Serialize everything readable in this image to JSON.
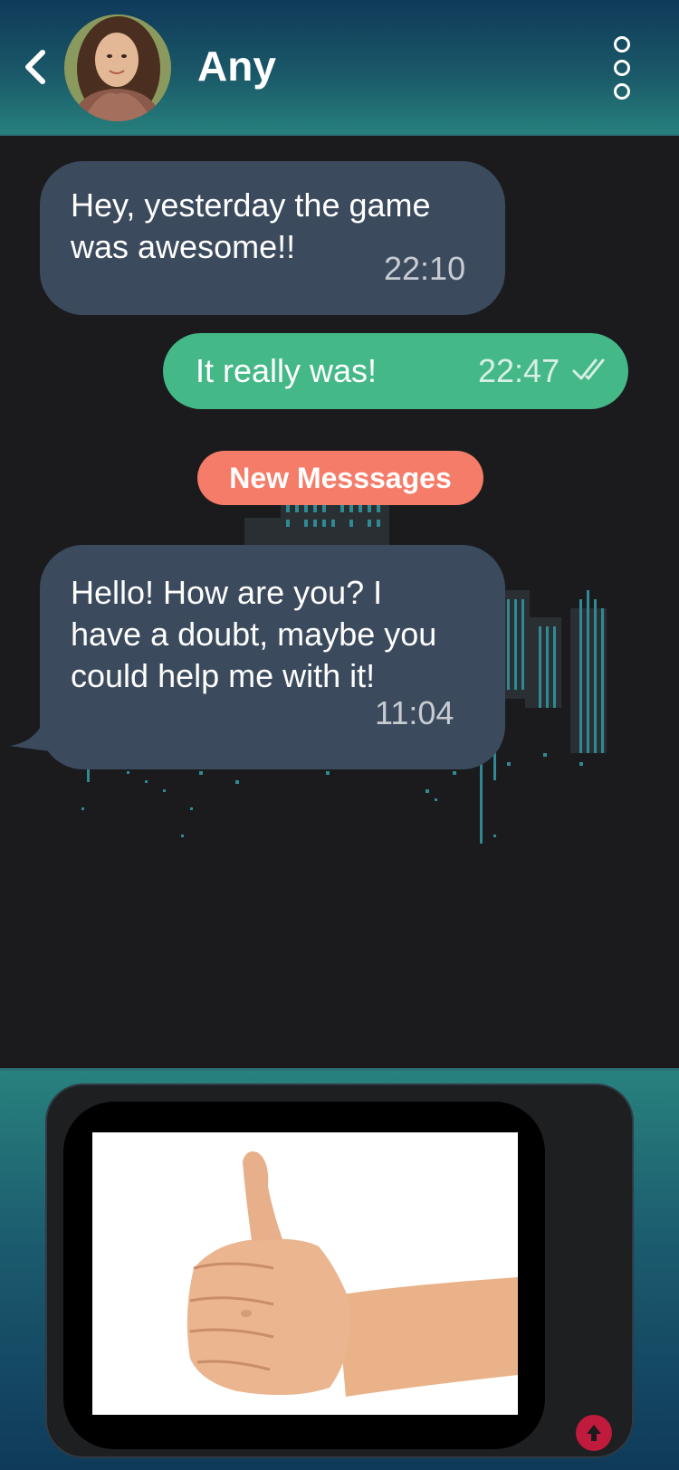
{
  "header": {
    "contact_name": "Any",
    "back_icon": "chevron-left-icon",
    "menu_icon": "more-vertical-icon"
  },
  "messages": [
    {
      "direction": "incoming",
      "text": "Hey, yesterday the game was awesome!!",
      "time": "22:10"
    },
    {
      "direction": "outgoing",
      "text": "It really was!",
      "time": "22:47",
      "status_icon": "double-check-icon"
    },
    {
      "direction": "incoming",
      "text": "Hello! How are you? I have a doubt, maybe you could help me with it!",
      "time": "11:04"
    }
  ],
  "divider": {
    "label": "New Messsages"
  },
  "composer": {
    "attachment": "thumbs-up-photo",
    "send_icon": "arrow-up-icon"
  },
  "colors": {
    "header_top": "#0f3a5a",
    "header_bottom": "#27807c",
    "incoming_bubble": "#3b4a5c",
    "outgoing_bubble": "#45b888",
    "badge": "#f47c68",
    "send_button": "#c01a3c",
    "background": "#1b1b1d"
  }
}
